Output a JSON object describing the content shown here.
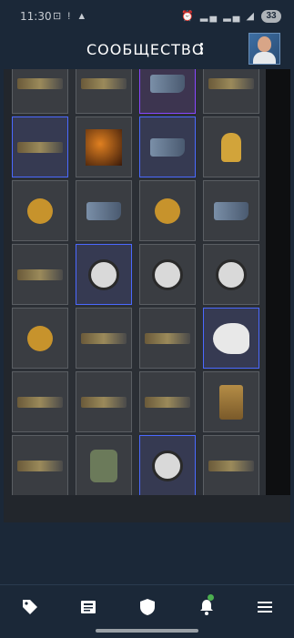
{
  "status_bar": {
    "time": "11:30",
    "battery": "33"
  },
  "header": {
    "title": "СООБЩЕСТВО"
  },
  "grid": {
    "tiles": [
      {
        "type": "gun",
        "rarity": "normal"
      },
      {
        "type": "gun",
        "rarity": "normal"
      },
      {
        "type": "pistol",
        "rarity": "purple"
      },
      {
        "type": "gun",
        "rarity": "normal"
      },
      {
        "type": "gun",
        "rarity": "blue"
      },
      {
        "type": "album",
        "rarity": "normal"
      },
      {
        "type": "pistol",
        "rarity": "blue"
      },
      {
        "type": "hand",
        "rarity": "normal"
      },
      {
        "type": "sticker",
        "rarity": "normal"
      },
      {
        "type": "pistol",
        "rarity": "normal"
      },
      {
        "type": "sticker",
        "rarity": "normal"
      },
      {
        "type": "pistol",
        "rarity": "normal"
      },
      {
        "type": "gun",
        "rarity": "normal"
      },
      {
        "type": "patch",
        "rarity": "blue"
      },
      {
        "type": "patch",
        "rarity": "normal"
      },
      {
        "type": "patch",
        "rarity": "normal"
      },
      {
        "type": "sticker",
        "rarity": "normal"
      },
      {
        "type": "gun",
        "rarity": "normal"
      },
      {
        "type": "gun",
        "rarity": "normal"
      },
      {
        "type": "panther",
        "rarity": "blue"
      },
      {
        "type": "gun",
        "rarity": "normal"
      },
      {
        "type": "gun",
        "rarity": "normal"
      },
      {
        "type": "gun",
        "rarity": "normal"
      },
      {
        "type": "smg",
        "rarity": "normal"
      },
      {
        "type": "gun",
        "rarity": "normal"
      },
      {
        "type": "glove",
        "rarity": "normal"
      },
      {
        "type": "patch",
        "rarity": "blue"
      },
      {
        "type": "gun",
        "rarity": "normal"
      }
    ]
  },
  "nav": {
    "items": [
      {
        "icon": "tag-icon"
      },
      {
        "icon": "news-icon"
      },
      {
        "icon": "shield-icon"
      },
      {
        "icon": "bell-icon"
      },
      {
        "icon": "menu-icon"
      }
    ]
  }
}
